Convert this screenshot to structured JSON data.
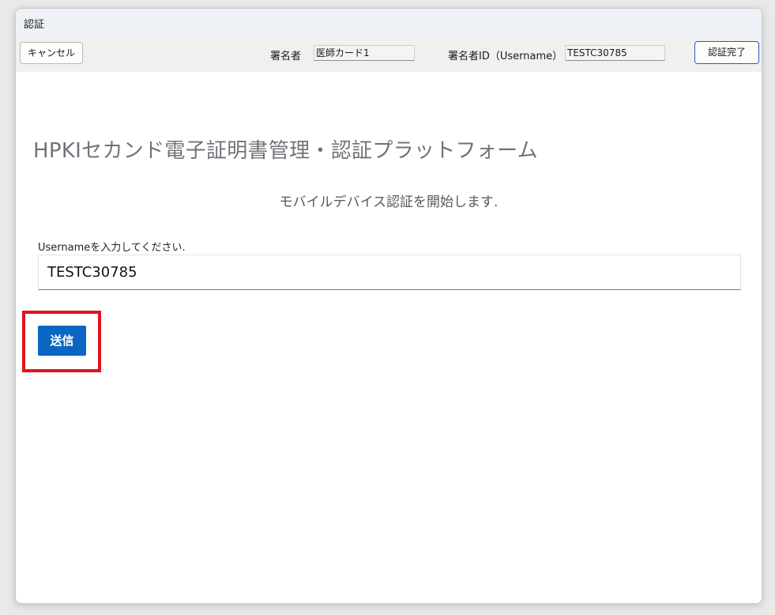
{
  "window": {
    "title": "認証"
  },
  "toolbar": {
    "cancel_label": "キャンセル",
    "signer_label": "署名者",
    "signer_value": "医師カード1",
    "signer_id_label": "署名者ID（Username）",
    "signer_id_value": "TESTC30785",
    "complete_label": "認証完了"
  },
  "main": {
    "page_title": "HPKIセカンド電子証明書管理・認証プラットフォーム",
    "subtitle": "モバイルデバイス認証を開始します.",
    "username_label": "Usernameを入力してください.",
    "username_value": "TESTC30785",
    "submit_label": "送信"
  },
  "colors": {
    "accent": "#0a66c2",
    "highlight": "#e0131e",
    "title_text": "#6f7378"
  }
}
